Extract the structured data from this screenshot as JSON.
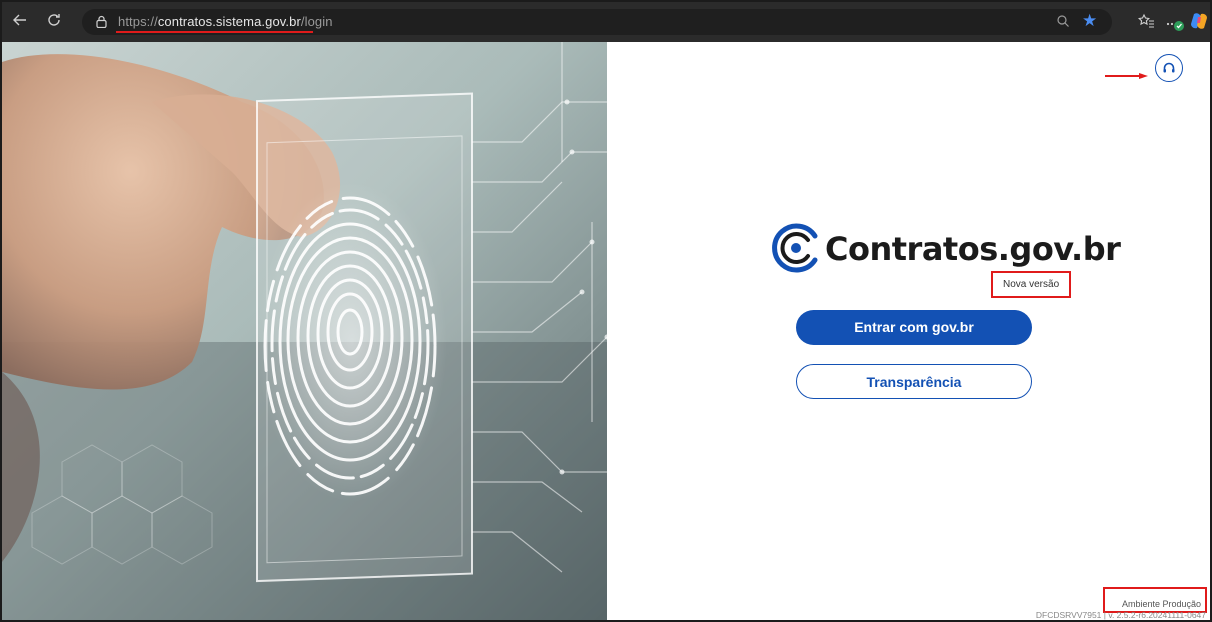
{
  "browser": {
    "url_scheme": "https://",
    "url_host": "contratos.sistema.gov.br",
    "url_path": "/login",
    "accent_color": "#4a8cf0",
    "icons": [
      "back-arrow-icon",
      "refresh-icon",
      "lock-icon",
      "zoom-icon",
      "star-icon",
      "favorites-icon",
      "extensions-icon",
      "copilot-icon"
    ]
  },
  "hero": {
    "icon": "fingerprint-icon"
  },
  "panel": {
    "brand_name": "Contratos.gov.br",
    "version_label": "Nova versão",
    "login_button_prefix": "Entrar com ",
    "login_button_brand": "gov.br",
    "transparency_label": "Transparência",
    "environment_label": "Ambiente Produção",
    "build_label": "DFCDSRVV7951 | v. 2.5.2-r6.20241111-0647",
    "primary_color": "#1351b4",
    "highlight_color": "#e01b1b"
  }
}
